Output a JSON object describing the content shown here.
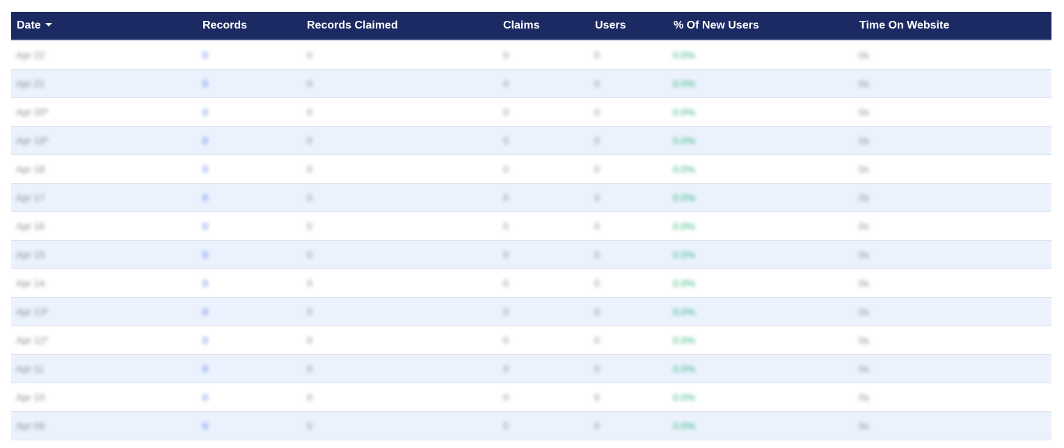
{
  "table": {
    "columns": [
      {
        "key": "date",
        "label": "Date"
      },
      {
        "key": "records",
        "label": "Records"
      },
      {
        "key": "records_claimed",
        "label": "Records Claimed"
      },
      {
        "key": "claims",
        "label": "Claims"
      },
      {
        "key": "users",
        "label": "Users"
      },
      {
        "key": "pct_new_users",
        "label": "% Of New Users"
      },
      {
        "key": "time_on_website",
        "label": "Time On Website"
      }
    ],
    "sort": {
      "column": "date",
      "direction": "descending",
      "icon": "caret-down-icon"
    },
    "colors": {
      "header_bg": "#1b2a63",
      "header_text": "#ffffff",
      "row_alt_bg": "#ebf2fe",
      "records_link": "#4a6be0",
      "pct_positive": "#2fb37a",
      "muted_text": "#8c8c8c"
    },
    "rows": [
      {
        "date": "Apr 22",
        "records": "0",
        "records_claimed": "0",
        "claims": "0",
        "users": "0",
        "pct_new_users": "0.0%",
        "time_on_website": "0s"
      },
      {
        "date": "Apr 21",
        "records": "0",
        "records_claimed": "0",
        "claims": "0",
        "users": "0",
        "pct_new_users": "0.0%",
        "time_on_website": "0s"
      },
      {
        "date": "Apr 20*",
        "records": "0",
        "records_claimed": "0",
        "claims": "0",
        "users": "0",
        "pct_new_users": "0.0%",
        "time_on_website": "0s"
      },
      {
        "date": "Apr 19*",
        "records": "0",
        "records_claimed": "0",
        "claims": "0",
        "users": "0",
        "pct_new_users": "0.0%",
        "time_on_website": "0s"
      },
      {
        "date": "Apr 18",
        "records": "0",
        "records_claimed": "0",
        "claims": "0",
        "users": "0",
        "pct_new_users": "0.0%",
        "time_on_website": "0s"
      },
      {
        "date": "Apr 17",
        "records": "0",
        "records_claimed": "0",
        "claims": "0",
        "users": "0",
        "pct_new_users": "0.0%",
        "time_on_website": "0s"
      },
      {
        "date": "Apr 16",
        "records": "0",
        "records_claimed": "0",
        "claims": "0",
        "users": "0",
        "pct_new_users": "0.0%",
        "time_on_website": "0s"
      },
      {
        "date": "Apr 15",
        "records": "0",
        "records_claimed": "0",
        "claims": "0",
        "users": "0",
        "pct_new_users": "0.0%",
        "time_on_website": "0s"
      },
      {
        "date": "Apr 14",
        "records": "0",
        "records_claimed": "0",
        "claims": "0",
        "users": "0",
        "pct_new_users": "0.0%",
        "time_on_website": "0s"
      },
      {
        "date": "Apr 13*",
        "records": "0",
        "records_claimed": "0",
        "claims": "0",
        "users": "0",
        "pct_new_users": "0.0%",
        "time_on_website": "0s"
      },
      {
        "date": "Apr 12*",
        "records": "0",
        "records_claimed": "0",
        "claims": "0",
        "users": "0",
        "pct_new_users": "0.0%",
        "time_on_website": "0s"
      },
      {
        "date": "Apr 11",
        "records": "0",
        "records_claimed": "0",
        "claims": "0",
        "users": "0",
        "pct_new_users": "0.0%",
        "time_on_website": "0s"
      },
      {
        "date": "Apr 10",
        "records": "0",
        "records_claimed": "0",
        "claims": "0",
        "users": "0",
        "pct_new_users": "0.0%",
        "time_on_website": "0s"
      },
      {
        "date": "Apr 09",
        "records": "0",
        "records_claimed": "0",
        "claims": "0",
        "users": "0",
        "pct_new_users": "0.0%",
        "time_on_website": "0s"
      }
    ]
  }
}
